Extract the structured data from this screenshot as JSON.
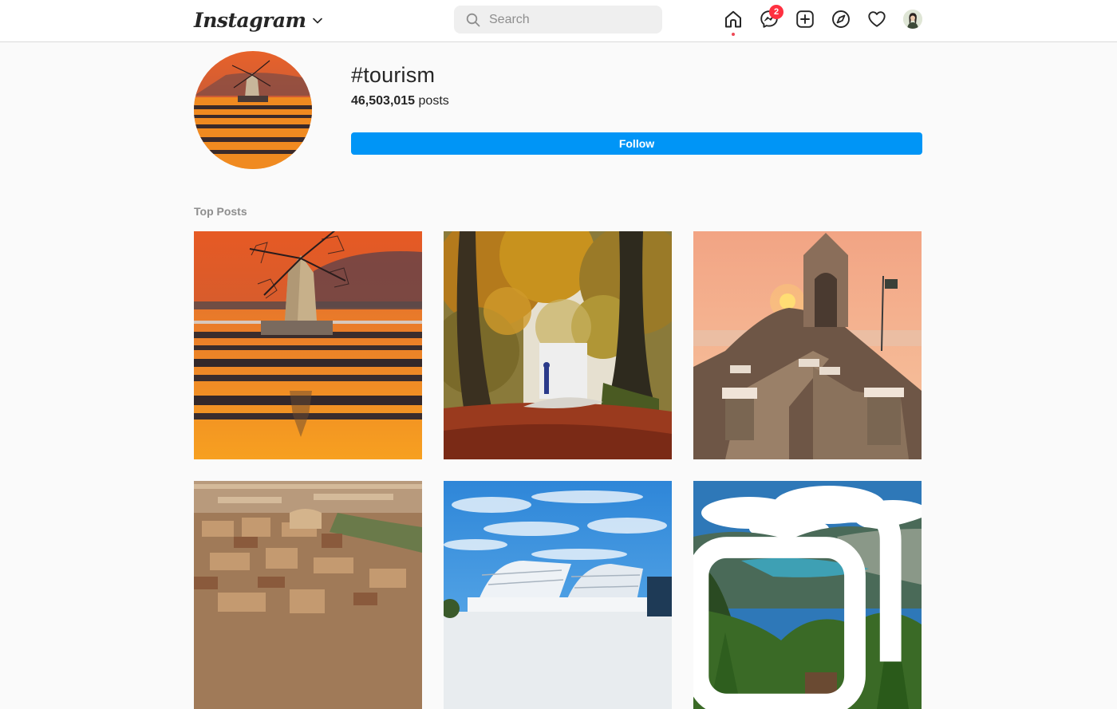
{
  "app": {
    "logo_text": "Instagram"
  },
  "search": {
    "placeholder": "Search"
  },
  "nav": {
    "items": [
      "home-icon",
      "messenger-icon",
      "new-post-icon",
      "explore-icon",
      "activity-heart-icon",
      "profile-avatar"
    ],
    "messages_badge": "2",
    "active_item": "home-icon",
    "accent_color": "#ed4956"
  },
  "hashtag": {
    "name": "#tourism",
    "post_count": "46,503,015",
    "posts_label": "posts",
    "follow_label": "Follow",
    "follow_color": "#0095f6"
  },
  "section": {
    "title": "Top Posts"
  },
  "posts": [
    {
      "subject": "windmill at sunset over salt pans"
    },
    {
      "subject": "autumn forest with hiker in snow"
    },
    {
      "subject": "stone chapel on cliff at sunset"
    },
    {
      "subject": "aerial view of old city rooftops"
    },
    {
      "subject": "white modern building under blue sky"
    },
    {
      "subject": "alpine lake valley with clouds",
      "multiple": true
    }
  ]
}
